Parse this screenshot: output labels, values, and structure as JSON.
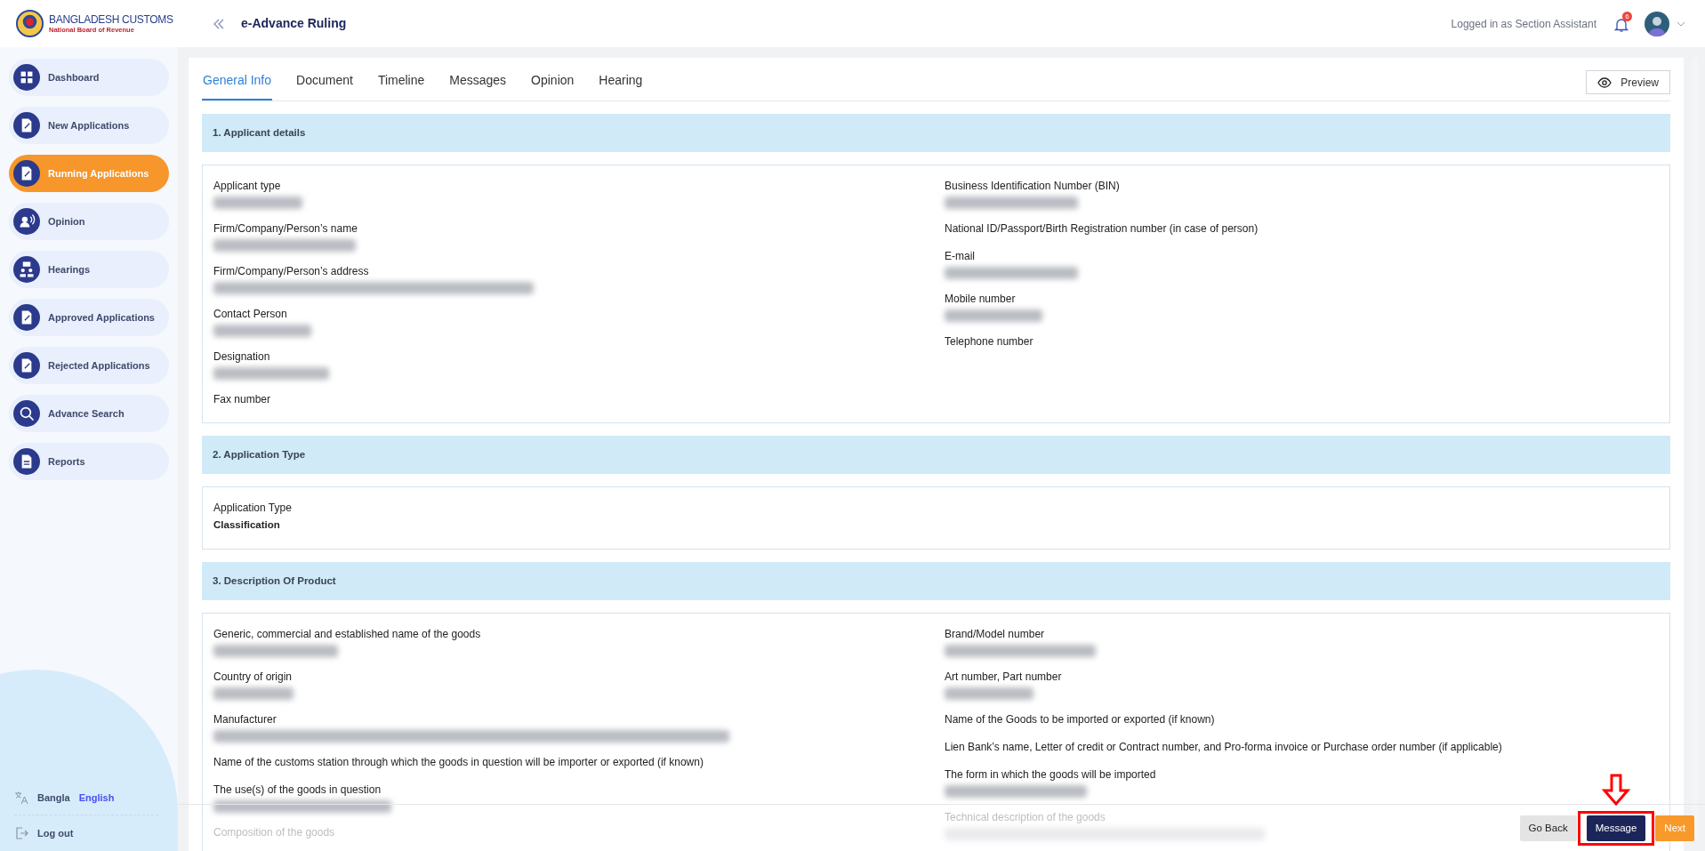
{
  "header": {
    "logo_title": "BANGLADESH CUSTOMS",
    "logo_subtitle": "National Board of Revenue",
    "page_title": "e-Advance Ruling",
    "login_text": "Logged in as Section Assistant",
    "notification_count": "6"
  },
  "sidebar": {
    "items": [
      {
        "label": "Dashboard",
        "selected": false
      },
      {
        "label": "New Applications",
        "selected": false
      },
      {
        "label": "Running Applications",
        "selected": true
      },
      {
        "label": "Opinion",
        "selected": false
      },
      {
        "label": "Hearings",
        "selected": false
      },
      {
        "label": "Approved Applications",
        "selected": false
      },
      {
        "label": "Rejected Applications",
        "selected": false
      },
      {
        "label": "Advance Search",
        "selected": false
      },
      {
        "label": "Reports",
        "selected": false
      }
    ],
    "languages": [
      {
        "label": "Bangla",
        "selected": false
      },
      {
        "label": "English",
        "selected": true
      }
    ],
    "logout": "Log out"
  },
  "tabs": [
    {
      "label": "General Info",
      "selected": true
    },
    {
      "label": "Document",
      "selected": false
    },
    {
      "label": "Timeline",
      "selected": false
    },
    {
      "label": "Messages",
      "selected": false
    },
    {
      "label": "Opinion",
      "selected": false
    },
    {
      "label": "Hearing",
      "selected": false
    }
  ],
  "preview_button": "Preview",
  "sections": [
    {
      "title": "1. Applicant details",
      "left": [
        {
          "label": "Applicant type",
          "blurred": true,
          "faded": false
        },
        {
          "label": "Firm/Company/Person’s name",
          "blurred": true,
          "faded": false
        },
        {
          "label": "Firm/Company/Person’s address",
          "blurred": true,
          "faded": false
        },
        {
          "label": "Contact Person",
          "blurred": true,
          "faded": false
        },
        {
          "label": "Designation",
          "blurred": true,
          "faded": false
        },
        {
          "label": "Fax number",
          "blurred": false,
          "faded": false
        }
      ],
      "right": [
        {
          "label": "Business Identification Number (BIN)",
          "blurred": true,
          "faded": false
        },
        {
          "label": "National ID/Passport/Birth Registration number (in case of person)",
          "blurred": false,
          "faded": false
        },
        {
          "label": "E-mail",
          "blurred": true,
          "faded": false
        },
        {
          "label": "Mobile number",
          "blurred": true,
          "faded": false
        },
        {
          "label": "Telephone number",
          "blurred": false,
          "faded": false
        }
      ]
    },
    {
      "title": "2. Application Type",
      "left": [
        {
          "label": "Application Type",
          "value": "Classification",
          "blurred": false,
          "faded": false
        }
      ]
    },
    {
      "title": "3. Description Of Product",
      "left": [
        {
          "label": "Generic, commercial and established name of the goods",
          "blurred": true,
          "faded": false
        },
        {
          "label": "Country of origin",
          "blurred": true,
          "faded": false
        },
        {
          "label": "Manufacturer",
          "blurred": true,
          "faded": false
        },
        {
          "label": "Name of the customs station through which the goods in question will be importer or exported (if known)",
          "blurred": false,
          "faded": false
        },
        {
          "label": "The use(s) of the goods in question",
          "blurred": true,
          "faded": false
        },
        {
          "label": "Composition of the goods",
          "blurred": false,
          "faded": true
        }
      ],
      "right": [
        {
          "label": "Brand/Model number",
          "blurred": true,
          "faded": false
        },
        {
          "label": "Art number, Part number",
          "blurred": true,
          "faded": false
        },
        {
          "label": "Name of the Goods to be imported or exported (if known)",
          "blurred": false,
          "faded": false
        },
        {
          "label": "Lien Bank’s name, Letter of credit or Contract number, and Pro-forma invoice or Purchase order number (if applicable)",
          "blurred": false,
          "faded": false
        },
        {
          "label": "The form in which the goods will be imported",
          "blurred": true,
          "faded": false
        },
        {
          "label": "Technical description of the goods",
          "blurred": true,
          "faded": true
        }
      ]
    }
  ],
  "footer_buttons": [
    {
      "label": "Go Back",
      "kind": "secondary",
      "highlighted": false
    },
    {
      "label": "Message",
      "kind": "primary",
      "highlighted": true
    },
    {
      "label": "Next",
      "kind": "accent",
      "highlighted": false
    }
  ]
}
